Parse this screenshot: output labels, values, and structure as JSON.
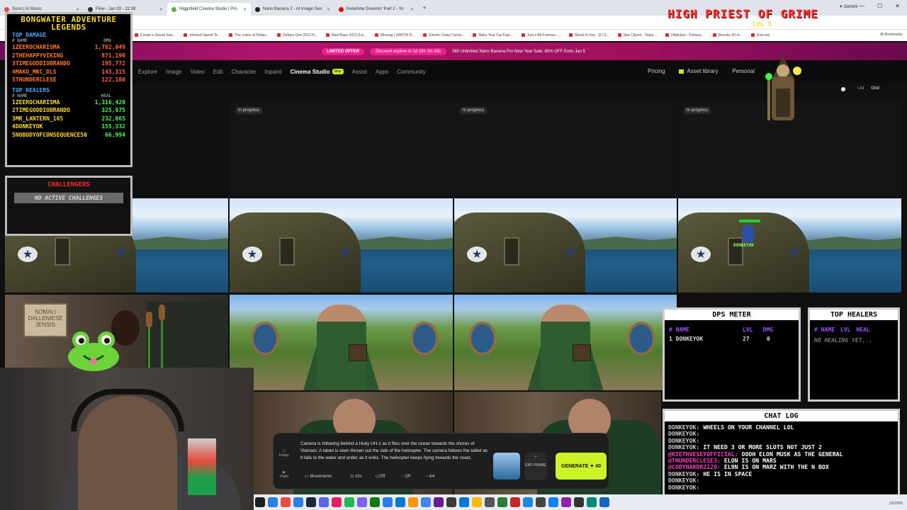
{
  "browser": {
    "tabs": [
      {
        "title": "Suno | AI Music",
        "color": "#e74c3c",
        "active": false
      },
      {
        "title": "Flow - Jan 03 - 22:39",
        "color": "#333333",
        "active": false
      },
      {
        "title": "Higgsfield Cinema Studio | Pro",
        "color": "#5ab73a",
        "active": true
      },
      {
        "title": "Nano Banana 2 - AI Image Gen",
        "color": "#222222",
        "active": false
      },
      {
        "title": "Ketamine Dreamin' Part 2 - Yo",
        "color": "#ff0000",
        "active": false
      }
    ],
    "gemini_label": "Gemini",
    "bookmarks": [
      "Create a Sound Sea...",
      "Infrared Speed Te...",
      "The colors of Defqo...",
      "Defqon One 2013 H...",
      "Hard Bass 2013 (Liv...",
      "Mixmag | WATCH D...",
      "Electric Daisy Carniv...",
      "Make Your Car Fast...",
      "Just a Bit Fortress -...",
      "Mixed In Key - DJ S...",
      "Star Citizen - Yogur...",
      "Villalobos - Fizheuz...",
      "Bonobo 50 m...",
      "Kotz.net"
    ],
    "all_bookmarks": "All Bookmarks"
  },
  "promo": {
    "limited_offer": "LIMITED OFFER",
    "discount": "Discount expires in 1d 19h 1m 43s",
    "message": "365 Unlimited Nano Banana Pro New Year Sale: 80% OFF Ends Jan 5"
  },
  "nav": {
    "items": [
      "Explore",
      "Image",
      "Video",
      "Edit",
      "Character",
      "Inpaint",
      "Cinema Studio",
      "Assist",
      "Apps",
      "Community"
    ],
    "active": "Cinema Studio",
    "new_badge": "New",
    "pricing": "Pricing",
    "asset_library": "Asset library",
    "personal": "Personal",
    "view_list": "List",
    "view_grid": "Grid"
  },
  "grid": {
    "in_progress_label": "In progress",
    "somali_sign": "SOMALI DALLENIESE JENSIS"
  },
  "prompt": {
    "text": "Camera is following behind a Huey UH-1 as it flies over the ocean towards the shores of Vietnam. A tablet is seen thrown out the side of the helicopter. The camera follows the tablet as it falls to the water and under as it sinks. The helicopter keeps flying towards the coast.",
    "side_image": "Image",
    "side_video": "Video",
    "movements": "Movements",
    "duration": "10s",
    "audio": "Off",
    "slowmo": "Off",
    "count": "4/4",
    "end_frame": "END FRAME",
    "generate": "GENERATE",
    "cost": "40"
  },
  "overlay": {
    "leaderboard": {
      "title": "BONGWATER ADVENTURE LEGENDS",
      "damage_title": "TOP DAMAGE",
      "healers_title": "TOP HEALERS",
      "hdr_name": "# NAME",
      "hdr_dmg": "DMG",
      "hdr_heal": "HEAL",
      "damage": [
        {
          "name": "1ZEEROCHARISMA",
          "value": "1,702,049"
        },
        {
          "name": "2THEHAPPYVIKING",
          "value": "871,190"
        },
        {
          "name": "3TIMEGODDIOBRANDO",
          "value": "195,772"
        },
        {
          "name": "4MAKO_MKC_DLS",
          "value": "143,315"
        },
        {
          "name": "5THUNDERCLESE",
          "value": "122,180"
        }
      ],
      "healers": [
        {
          "name": "1ZEEROCHARISMA",
          "value": "1,316,420"
        },
        {
          "name": "2TIMEGODDIOBRANDO",
          "value": "325,975"
        },
        {
          "name": "3MR_LANTERN_165",
          "value": "232,865"
        },
        {
          "name": "4DONKEYOK",
          "value": "155,332"
        },
        {
          "name": "5NOBODYOFCONSEQUENCE50",
          "value": "66,994"
        }
      ]
    },
    "challengers": {
      "title": "CHALLENGERS",
      "status": "NO ACTIVE CHALLENGES"
    },
    "dps": {
      "title": "DPS METER",
      "hdr_name": "# NAME",
      "hdr_lvl": "LVL",
      "hdr_dmg": "DMG",
      "row": {
        "rank": "1",
        "name": "DONKEYOK",
        "lvl": "27",
        "dmg": "0"
      }
    },
    "top_healers": {
      "title": "TOP HEALERS",
      "hdr_name": "# NAME",
      "hdr_lvl": "LVL",
      "hdr_heal": "HEAL",
      "empty": "NO HEALING YET..."
    },
    "chat": {
      "title": "CHAT LOG",
      "lines": [
        {
          "user": "DONKEYOK:",
          "msg": "WHEELS ON YOUR CHANNEL LOL",
          "pink": false
        },
        {
          "user": "DONKEYOK:",
          "msg": "",
          "pink": false
        },
        {
          "user": "DONKEYOK:",
          "msg": "",
          "pink": false
        },
        {
          "user": "DONKEYOK:",
          "msg": "IT NEED 3 OR MORE SLOTS NOT JUST 2",
          "pink": false
        },
        {
          "user": "@KIETHVESEYOFFICIAL:",
          "msg": "OOOH ELON MUSK AS THE GENERAL",
          "pink": true
        },
        {
          "user": "@THUNDERCLESE3:",
          "msg": "ELON IS ON MARS",
          "pink": true
        },
        {
          "user": "@CODYNARDR2129:",
          "msg": "EL9N IS ON MARZ WITH THE N BOX",
          "pink": true
        },
        {
          "user": "DONKEYOK:",
          "msg": "HE IS IN SPACE",
          "pink": false
        },
        {
          "user": "DONKEYOK:",
          "msg": "",
          "pink": false
        },
        {
          "user": "DONKEYOK:",
          "msg": "",
          "pink": false
        }
      ]
    },
    "boss_name": "HIGH PRIEST OF GRIME",
    "boss_level": "LVL 5",
    "avatar_name": "DONKEYOK"
  },
  "taskbar": {
    "time": "1/5/2026"
  }
}
